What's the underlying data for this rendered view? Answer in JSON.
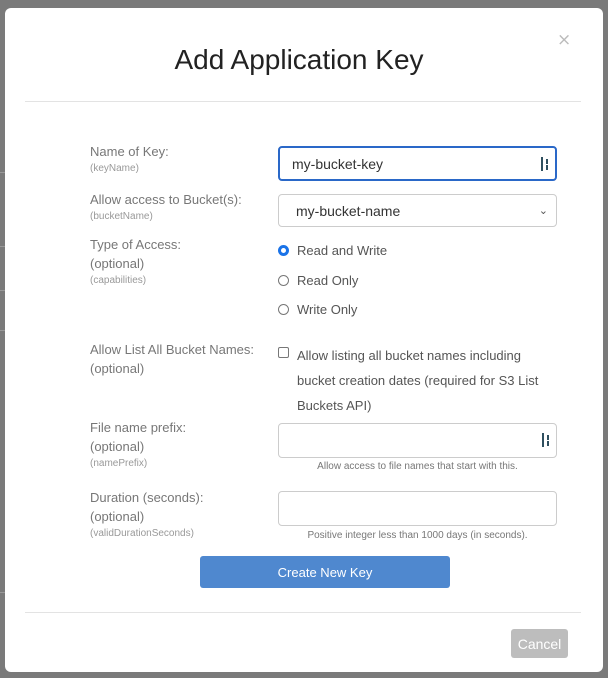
{
  "dialog": {
    "title": "Add Application Key",
    "close_label": "×",
    "fields": {
      "name": {
        "label": "Name of Key:",
        "sub": "(keyName)",
        "value": "my-bucket-key"
      },
      "bucket": {
        "label": "Allow access to Bucket(s):",
        "sub": "(bucketName)",
        "value": "my-bucket-name"
      },
      "access": {
        "label": "Type of Access:",
        "optional": "(optional)",
        "sub": "(capabilities)",
        "options": [
          "Read and Write",
          "Read Only",
          "Write Only"
        ],
        "selected": "Read and Write"
      },
      "listAll": {
        "label": "Allow List All Bucket Names:",
        "optional": "(optional)",
        "text": "Allow listing all bucket names including bucket creation dates (required for S3 List Buckets API)",
        "checked": false
      },
      "prefix": {
        "label": "File name prefix:",
        "optional": "(optional)",
        "sub": "(namePrefix)",
        "value": "",
        "help": "Allow access to file names that start with this."
      },
      "duration": {
        "label": "Duration (seconds):",
        "optional": "(optional)",
        "sub": "(validDurationSeconds)",
        "value": "",
        "help": "Positive integer less than 1000 days (in seconds)."
      }
    },
    "create_label": "Create New Key",
    "cancel_label": "Cancel"
  },
  "colors": {
    "accent": "#4f88cf",
    "focus": "#2a68c8"
  }
}
